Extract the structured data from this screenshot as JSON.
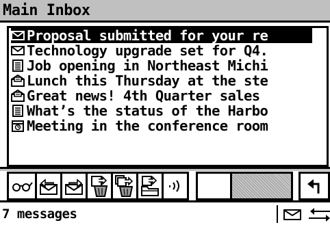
{
  "window": {
    "title": "Main Inbox"
  },
  "messages": [
    {
      "icon": "envelope-icon",
      "subject": "Proposal submitted for your re",
      "selected": true
    },
    {
      "icon": "envelope-icon",
      "subject": "Technology upgrade set for Q4.",
      "selected": false
    },
    {
      "icon": "document-icon",
      "subject": "Job opening in Northeast Michi",
      "selected": false
    },
    {
      "icon": "open-mail-icon",
      "subject": "Lunch this Thursday at the ste",
      "selected": false
    },
    {
      "icon": "open-mail-icon",
      "subject": "Great news! 4th Quarter sales",
      "selected": false
    },
    {
      "icon": "document-icon",
      "subject": "What’s the status of the Harbo",
      "selected": false
    },
    {
      "icon": "meeting-icon",
      "subject": "Meeting in the conference room",
      "selected": false
    }
  ],
  "toolbar": {
    "buttons": [
      {
        "name": "read-glasses-button",
        "icon": "glasses-icon"
      },
      {
        "name": "reply-button",
        "icon": "reply-icon"
      },
      {
        "name": "forward-button",
        "icon": "forward-icon"
      },
      {
        "name": "delete-button",
        "icon": "trash-icon"
      },
      {
        "name": "delete-all-button",
        "icon": "trash-multi-icon"
      },
      {
        "name": "file-button",
        "icon": "folder-icon"
      },
      {
        "name": "send-receive-button",
        "icon": "signal-icon"
      },
      {
        "name": "back-button",
        "icon": "return-arrow-icon"
      }
    ]
  },
  "status": {
    "count_text": "7 messages"
  },
  "colors": {
    "title_bg": "#c0c0c0",
    "selection_bg": "#000000",
    "text": "#000000"
  }
}
